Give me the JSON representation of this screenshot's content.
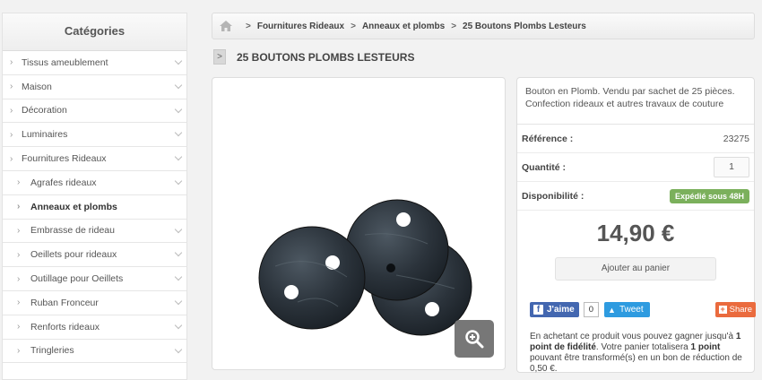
{
  "sidebar": {
    "title": "Catégories",
    "items": [
      {
        "label": "Tissus ameublement",
        "level": "top"
      },
      {
        "label": "Maison",
        "level": "top"
      },
      {
        "label": "Décoration",
        "level": "top"
      },
      {
        "label": "Luminaires",
        "level": "top"
      },
      {
        "label": "Fournitures Rideaux",
        "level": "top"
      },
      {
        "label": "Agrafes rideaux",
        "level": "sub"
      },
      {
        "label": "Anneaux et plombs",
        "level": "sub",
        "active": true
      },
      {
        "label": "Embrasse de rideau",
        "level": "sub"
      },
      {
        "label": "Oeillets pour rideaux",
        "level": "sub"
      },
      {
        "label": "Outillage pour Oeillets",
        "level": "sub"
      },
      {
        "label": "Ruban Fronceur",
        "level": "sub"
      },
      {
        "label": "Renforts rideaux",
        "level": "sub"
      },
      {
        "label": "Tringleries",
        "level": "sub"
      }
    ]
  },
  "breadcrumb": {
    "items": [
      "Fournitures Rideaux",
      "Anneaux et plombs",
      "25 Boutons Plombs Lesteurs"
    ],
    "separator": ">"
  },
  "product": {
    "title": "25 BOUTONS PLOMBS LESTEURS",
    "description": "Bouton en Plomb. Vendu par sachet de 25 pièces. Confection rideaux et autres travaux de couture",
    "reference_label": "Référence :",
    "reference_value": "23275",
    "quantity_label": "Quantité :",
    "quantity_value": "1",
    "availability_label": "Disponibilité :",
    "availability_badge": "Expédié sous 48H",
    "price": "14,90 €",
    "add_to_cart": "Ajouter au panier"
  },
  "social": {
    "facebook_label": "J'aime",
    "facebook_count": "0",
    "twitter_label": "Tweet",
    "share_label": "Share"
  },
  "loyalty": {
    "part1": "En achetant ce produit vous pouvez gagner jusqu'à ",
    "bold1": "1 point de fidélité",
    "part2": ". Votre panier totalisera ",
    "bold2": "1 point",
    "part3": " pouvant être transformé(s) en un bon de réduction de 0,50 €."
  },
  "colors": {
    "badge": "#7bb05c",
    "facebook": "#4367b0",
    "twitter": "#2e9be0",
    "share": "#ea6b3e"
  }
}
